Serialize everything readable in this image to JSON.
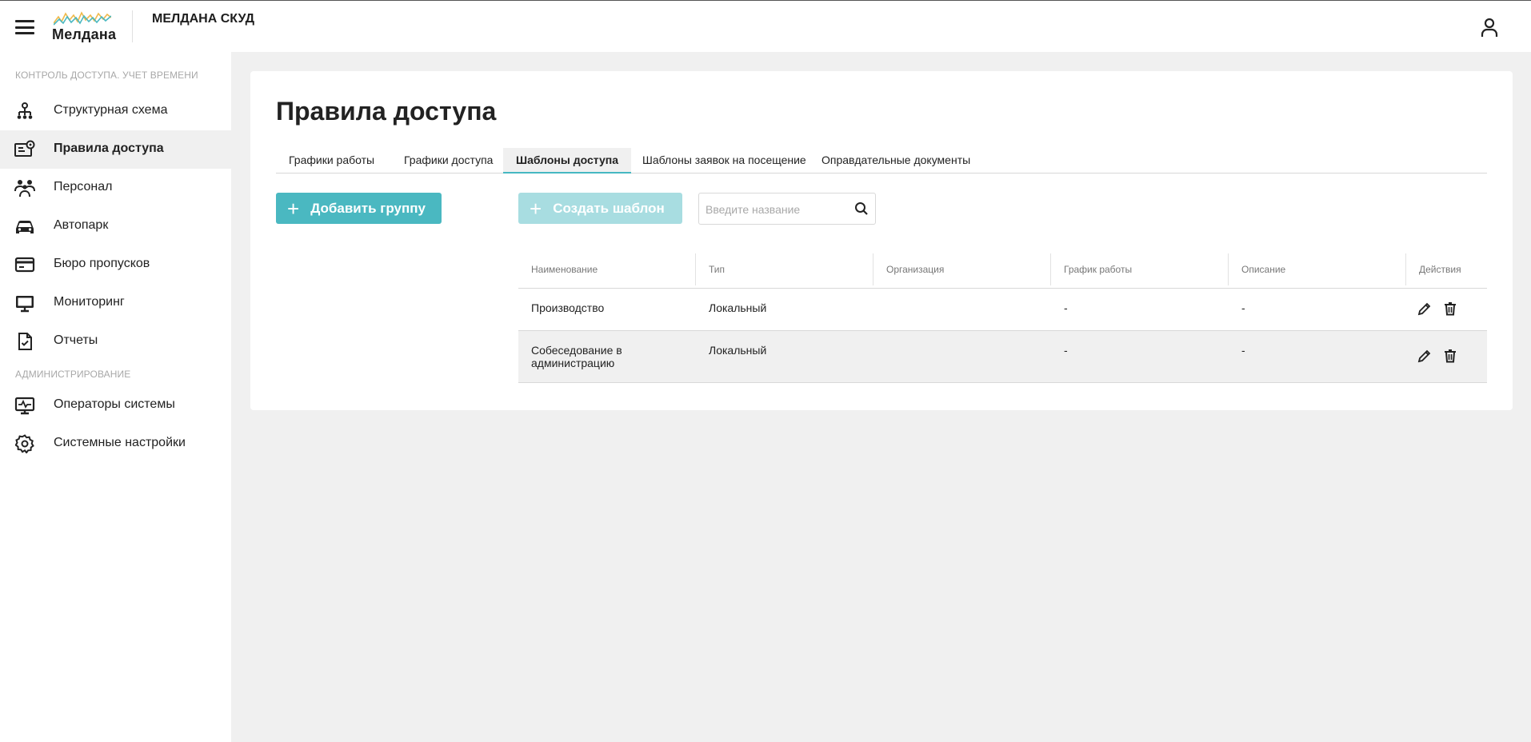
{
  "header": {
    "logo_text": "Мелдана",
    "app_title": "МЕЛДАНА СКУД"
  },
  "sidebar": {
    "section1_title": "КОНТРОЛЬ ДОСТУПА. УЧЕТ ВРЕМЕНИ",
    "section2_title": "АДМИНИСТРИРОВАНИЕ",
    "items": [
      {
        "label": "Структурная схема",
        "icon": "hierarchy-icon"
      },
      {
        "label": "Правила доступа",
        "icon": "access-rules-icon",
        "active": true
      },
      {
        "label": "Персонал",
        "icon": "people-icon"
      },
      {
        "label": "Автопарк",
        "icon": "car-icon"
      },
      {
        "label": "Бюро пропусков",
        "icon": "card-icon"
      },
      {
        "label": "Мониторинг",
        "icon": "monitor-icon"
      },
      {
        "label": "Отчеты",
        "icon": "report-icon"
      },
      {
        "label": "Операторы системы",
        "icon": "operators-icon"
      },
      {
        "label": "Системные настройки",
        "icon": "settings-icon"
      }
    ]
  },
  "main": {
    "title": "Правила доступа",
    "tabs": [
      {
        "label": "Графики работы"
      },
      {
        "label": "Графики доступа"
      },
      {
        "label": "Шаблоны доступа",
        "active": true
      },
      {
        "label": "Шаблоны заявок на посещение"
      },
      {
        "label": "Оправдательные документы"
      }
    ],
    "add_group_label": "Добавить группу",
    "create_template_label": "Создать шаблон",
    "search": {
      "placeholder": "Введите название",
      "value": ""
    }
  },
  "table": {
    "columns": [
      "Наименование",
      "Тип",
      "Организация",
      "График работы",
      "Описание",
      "Действия"
    ],
    "rows": [
      {
        "name": "Производство",
        "type": "Локальный",
        "org": "",
        "schedule": "-",
        "description": "-"
      },
      {
        "name": "Собеседование в администрацию",
        "type": "Локальный",
        "org": "",
        "schedule": "-",
        "description": "-"
      }
    ]
  },
  "colors": {
    "accent": "#4ab8c1",
    "accent_disabled": "#a8dde1",
    "background": "#f0f0f0"
  }
}
